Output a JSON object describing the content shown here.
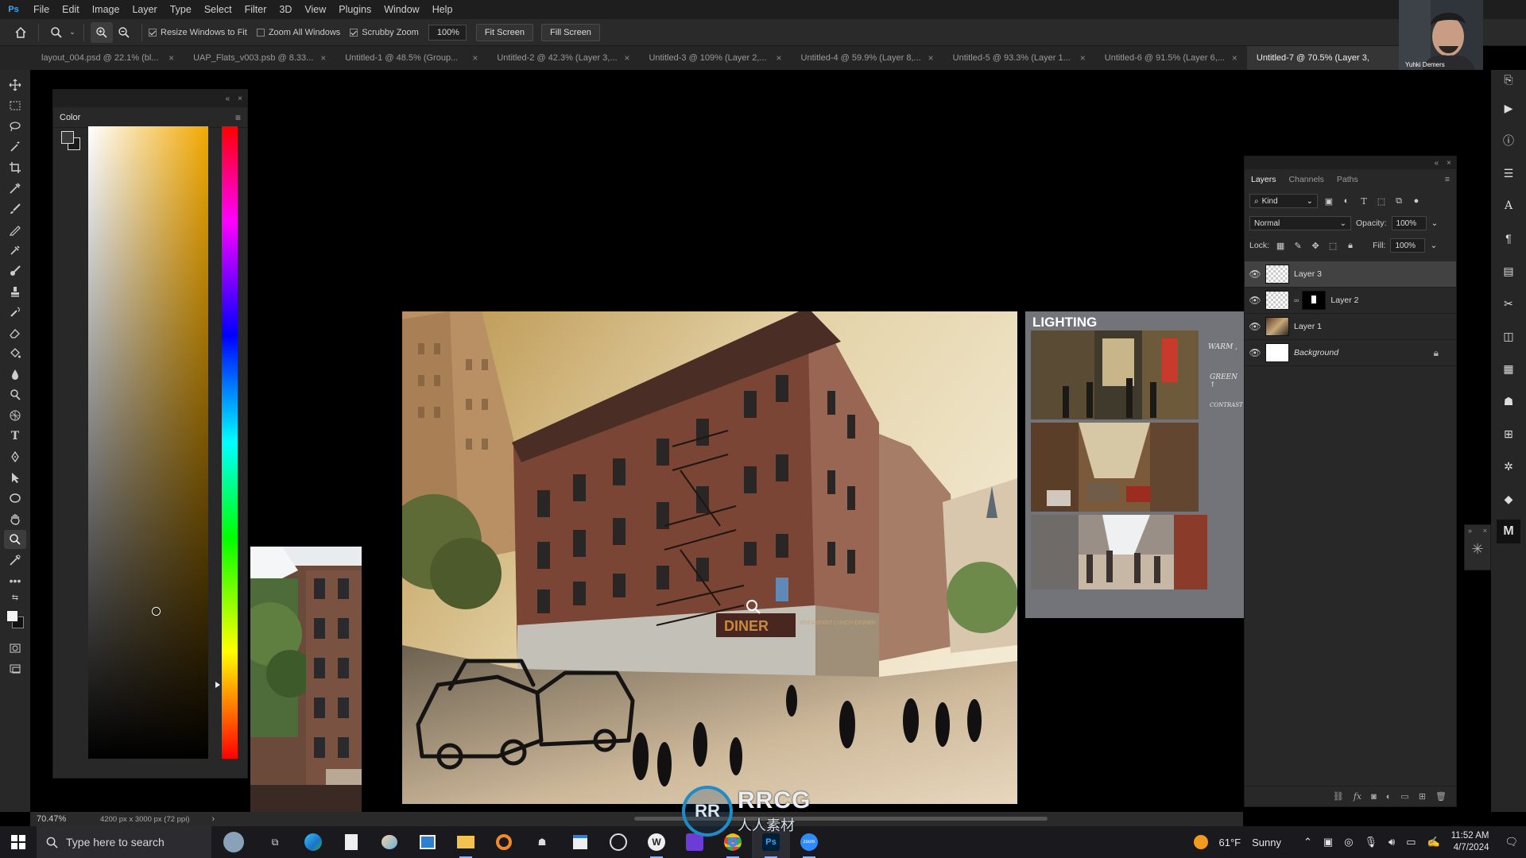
{
  "app": {
    "logo": "Ps"
  },
  "menu": [
    "File",
    "Edit",
    "Image",
    "Layer",
    "Type",
    "Select",
    "Filter",
    "3D",
    "View",
    "Plugins",
    "Window",
    "Help"
  ],
  "options": {
    "resize_windows": "Resize Windows to Fit",
    "zoom_all": "Zoom All Windows",
    "scrubby": "Scrubby Zoom",
    "zoom_value": "100%",
    "fit_screen": "Fit Screen",
    "fill_screen": "Fill Screen"
  },
  "tabs": [
    "layout_004.psd @ 22.1% (bl...",
    "UAP_Flats_v003.psb @ 8.33...",
    "Untitled-1 @ 48.5% (Group...",
    "Untitled-2 @ 42.3% (Layer 3,...",
    "Untitled-3 @ 109% (Layer 2,...",
    "Untitled-4 @ 59.9% (Layer 8,...",
    "Untitled-5 @ 93.3% (Layer 1...",
    "Untitled-6 @ 91.5% (Layer 6,...",
    "Untitled-7 @ 70.5% (Layer 3,"
  ],
  "color_panel": {
    "title": "Color"
  },
  "lighting_board": {
    "title": "LIGHTING",
    "notes": [
      "WARM ,",
      "GREEN ↑",
      "CONTRAST"
    ]
  },
  "painting": {
    "signs": [
      "DINER",
      "BREAKFAST LUNCH DINNER"
    ]
  },
  "status": {
    "zoom": "70.47%",
    "doc_info": "4200 px x 3000 px (72 ppi)"
  },
  "layers_panel": {
    "tabs": [
      "Layers",
      "Channels",
      "Paths"
    ],
    "filter_kind": "Kind",
    "blend_mode": "Normal",
    "opacity_label": "Opacity:",
    "opacity_value": "100%",
    "lock_label": "Lock:",
    "fill_label": "Fill:",
    "fill_value": "100%",
    "layers": [
      {
        "name": "Layer 3",
        "selected": true
      },
      {
        "name": "Layer 2",
        "selected": false
      },
      {
        "name": "Layer 1",
        "selected": false
      },
      {
        "name": "Background",
        "selected": false
      }
    ]
  },
  "webcam": {
    "name": "Yuhki Demers"
  },
  "taskbar": {
    "search_placeholder": "Type here to search",
    "weather_temp": "61°F",
    "weather_text": "Sunny",
    "time": "11:52 AM",
    "date": "4/7/2024"
  },
  "watermark": {
    "logo_text": "RR",
    "big": "RRCG",
    "small": "人人素材"
  },
  "colors": {
    "accent": "#31a8ff",
    "panel": "#282828",
    "menubar": "#1e1e1e",
    "selected_layer": "#424242"
  }
}
